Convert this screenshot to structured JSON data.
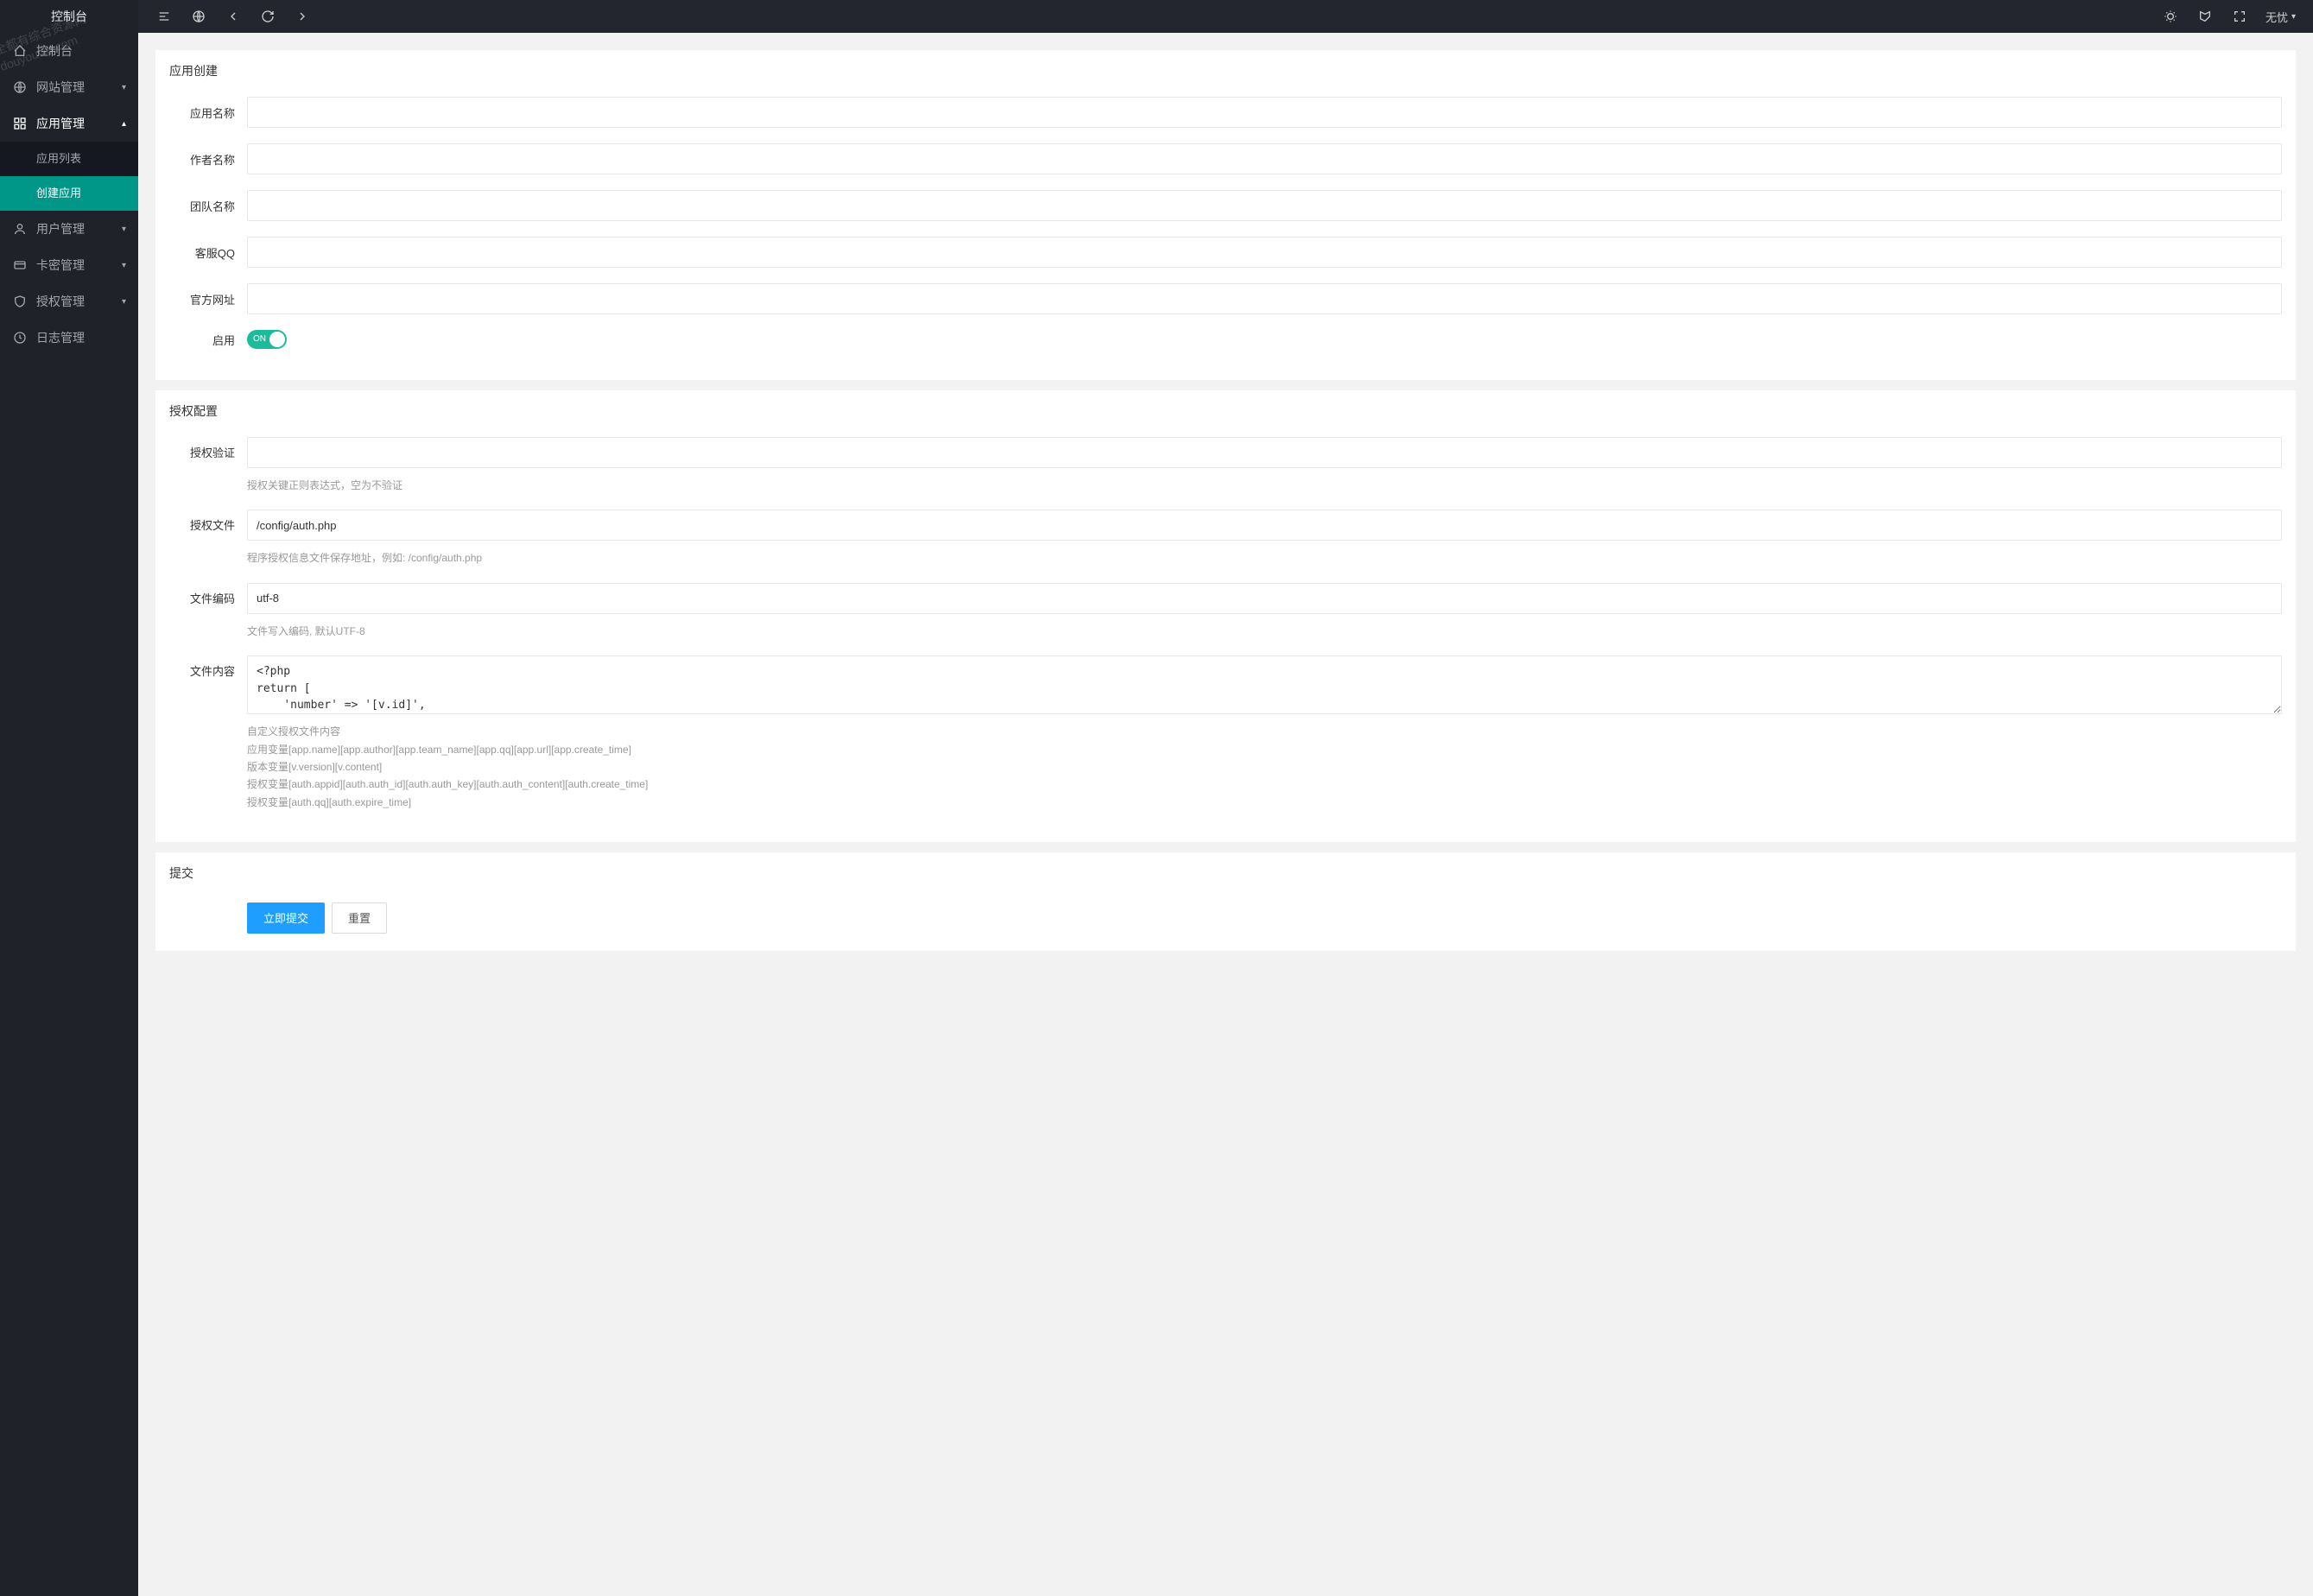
{
  "brand": "控制台",
  "watermark": {
    "line1": "全都有综合资源网",
    "line2": "douyouvip.com"
  },
  "sidebar": {
    "items": [
      {
        "label": "控制台",
        "icon": "home"
      },
      {
        "label": "网站管理",
        "icon": "globe",
        "arrow": true
      },
      {
        "label": "应用管理",
        "icon": "grid",
        "arrow": true,
        "expanded": true,
        "children": [
          {
            "label": "应用列表"
          },
          {
            "label": "创建应用",
            "active": true
          }
        ]
      },
      {
        "label": "用户管理",
        "icon": "user",
        "arrow": true
      },
      {
        "label": "卡密管理",
        "icon": "card",
        "arrow": true
      },
      {
        "label": "授权管理",
        "icon": "shield",
        "arrow": true
      },
      {
        "label": "日志管理",
        "icon": "clock"
      }
    ]
  },
  "header": {
    "user": "无忧"
  },
  "sections": {
    "create": {
      "title": "应用创建",
      "fields": {
        "app_name": {
          "label": "应用名称",
          "value": ""
        },
        "author": {
          "label": "作者名称",
          "value": ""
        },
        "team": {
          "label": "团队名称",
          "value": ""
        },
        "qq": {
          "label": "客服QQ",
          "value": ""
        },
        "url": {
          "label": "官方网址",
          "value": ""
        },
        "enabled": {
          "label": "启用",
          "on_text": "ON"
        }
      }
    },
    "auth": {
      "title": "授权配置",
      "fields": {
        "verify": {
          "label": "授权验证",
          "value": "",
          "help": "授权关键正则表达式，空为不验证"
        },
        "file": {
          "label": "授权文件",
          "value": "/config/auth.php",
          "help": "程序授权信息文件保存地址，例如: /config/auth.php"
        },
        "encoding": {
          "label": "文件编码",
          "value": "utf-8",
          "help": "文件写入编码, 默认UTF-8"
        },
        "content": {
          "label": "文件内容",
          "value": "<?php\nreturn [\n    'number' => '[v.id]',\n    'version' => '[v.version]',\n    'auth_id' => '[auth.auth_id]',",
          "help": "自定义授权文件内容\n应用变量[app.name][app.author][app.team_name][app.qq][app.url][app.create_time]\n版本变量[v.version][v.content]\n授权变量[auth.appid][auth.auth_id][auth.auth_key][auth.auth_content][auth.create_time]\n授权变量[auth.qq][auth.expire_time]"
        }
      }
    },
    "submit": {
      "title": "提交",
      "buttons": {
        "submit": "立即提交",
        "reset": "重置"
      }
    }
  }
}
